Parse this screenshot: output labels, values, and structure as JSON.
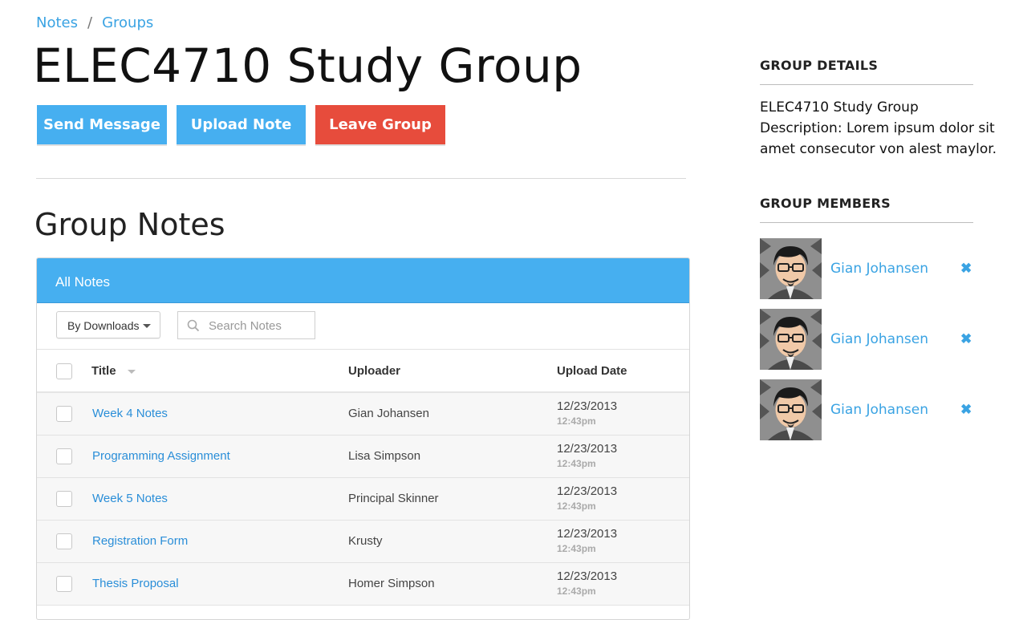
{
  "breadcrumb": {
    "items": [
      "Notes",
      "Groups"
    ],
    "separator": "/"
  },
  "page": {
    "title": "ELEC4710 Study Group"
  },
  "actions": {
    "send_message": "Send Message",
    "upload_note": "Upload Note",
    "leave_group": "Leave Group"
  },
  "notes": {
    "section_title": "Group Notes",
    "panel_title": "All Notes",
    "sort_dropdown": "By Downloads",
    "search_placeholder": "Search Notes",
    "columns": {
      "title": "Title",
      "uploader": "Uploader",
      "date": "Upload Date"
    },
    "rows": [
      {
        "title": "Week 4 Notes",
        "uploader": "Gian Johansen",
        "date": "12/23/2013",
        "time": "12:43pm"
      },
      {
        "title": "Programming Assignment",
        "uploader": "Lisa Simpson",
        "date": "12/23/2013",
        "time": "12:43pm"
      },
      {
        "title": "Week 5 Notes",
        "uploader": "Principal Skinner",
        "date": "12/23/2013",
        "time": "12:43pm"
      },
      {
        "title": "Registration Form",
        "uploader": "Krusty",
        "date": "12/23/2013",
        "time": "12:43pm"
      },
      {
        "title": "Thesis Proposal",
        "uploader": "Homer Simpson",
        "date": "12/23/2013",
        "time": "12:43pm"
      }
    ]
  },
  "sidebar": {
    "details_heading": "GROUP DETAILS",
    "details_name": "ELEC4710 Study Group",
    "details_description": "Description: Lorem ipsum dolor sit amet consecutor von alest maylor.",
    "members_heading": "GROUP MEMBERS",
    "members": [
      {
        "name": "Gian Johansen",
        "remove_icon": "close-icon"
      },
      {
        "name": "Gian Johansen",
        "remove_icon": "close-icon"
      },
      {
        "name": "Gian Johansen",
        "remove_icon": "close-icon"
      }
    ]
  },
  "colors": {
    "accent": "#46aff0",
    "link": "#2a8ed8",
    "danger": "#e74c3c"
  }
}
